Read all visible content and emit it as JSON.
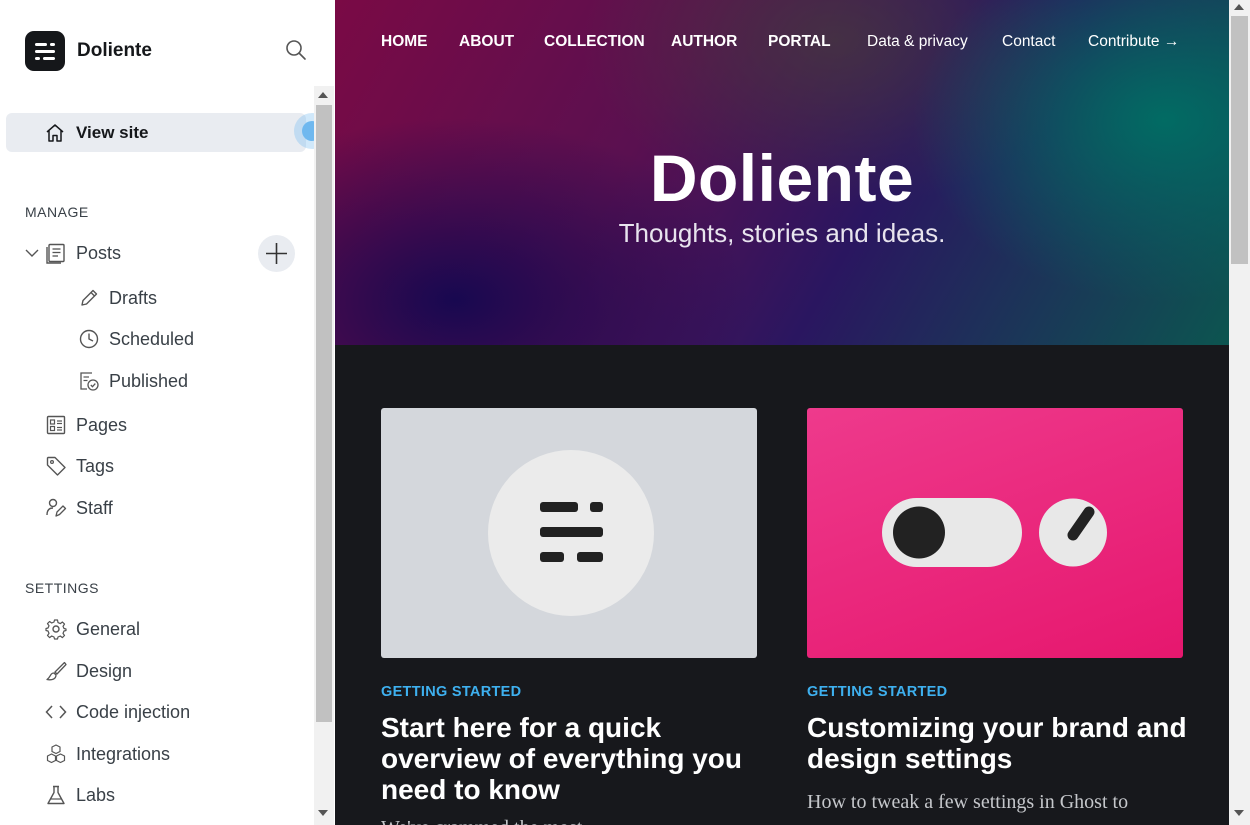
{
  "sidebar": {
    "brand_name": "Doliente",
    "view_site_label": "View site",
    "manage_label": "MANAGE",
    "settings_label": "SETTINGS",
    "posts_label": "Posts",
    "post_subitems": [
      {
        "label": "Drafts",
        "icon": "pencil-icon"
      },
      {
        "label": "Scheduled",
        "icon": "clock-icon"
      },
      {
        "label": "Published",
        "icon": "published-icon"
      }
    ],
    "manage_items": [
      {
        "label": "Pages",
        "icon": "pages-icon"
      },
      {
        "label": "Tags",
        "icon": "tag-icon"
      },
      {
        "label": "Staff",
        "icon": "staff-icon"
      }
    ],
    "settings_items": [
      {
        "label": "General",
        "icon": "gear-icon"
      },
      {
        "label": "Design",
        "icon": "brush-icon"
      },
      {
        "label": "Code injection",
        "icon": "code-icon"
      },
      {
        "label": "Integrations",
        "icon": "integrations-icon"
      },
      {
        "label": "Labs",
        "icon": "flask-icon"
      }
    ]
  },
  "site": {
    "nav_primary": [
      "HOME",
      "ABOUT",
      "COLLECTION",
      "AUTHOR",
      "PORTAL"
    ],
    "nav_secondary": [
      "Data & privacy",
      "Contact",
      "Contribute →"
    ],
    "title": "Doliente",
    "subtitle": "Thoughts, stories and ideas.",
    "cards": [
      {
        "tag": "GETTING STARTED",
        "title": "Start here for a quick overview of everything you need to know",
        "excerpt": "We've crammed the most",
        "image_bg": "#d4d7dc"
      },
      {
        "tag": "GETTING STARTED",
        "title": "Customizing your brand and design settings",
        "excerpt": "How to tweak a few settings in Ghost to",
        "image_bg": "#e8237a"
      }
    ]
  },
  "colors": {
    "accent_blue": "#3eb0ef",
    "brand_dark": "#15171a",
    "active_bg": "#e9ecf1"
  }
}
